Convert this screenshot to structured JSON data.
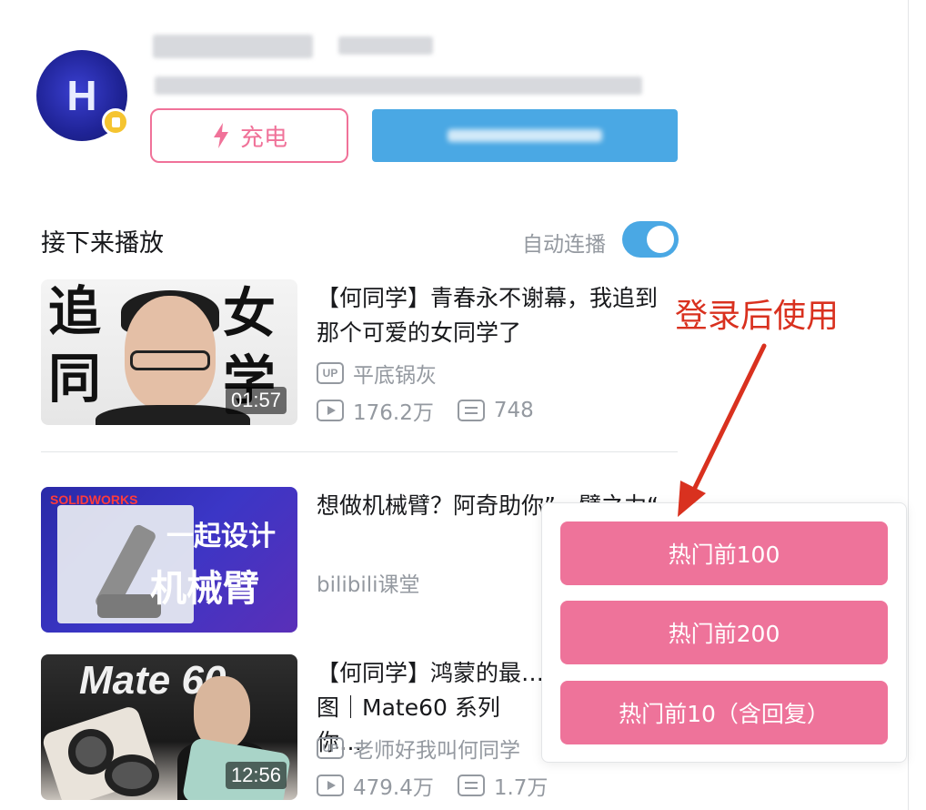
{
  "uploader": {
    "charge_label": "充电"
  },
  "next_up": {
    "title": "接下来播放",
    "autoplay_label": "自动连播",
    "autoplay_on": true
  },
  "videos": [
    {
      "title": "【何同学】青春永不谢幕，我追到那个可爱的女同学了",
      "uploader": "平底锅灰",
      "views": "176.2万",
      "danmaku": "748",
      "duration": "01:57",
      "thumb_text": [
        "追",
        "同",
        "女",
        "学"
      ]
    },
    {
      "title": "想做机械臂？阿奇助你”一臂之力“",
      "uploader": "bilibili课堂",
      "thumb_text": [
        "一起设计",
        "机械臂",
        "SOLIDWORKS"
      ]
    },
    {
      "title": "【何同学】鸿蒙的最…图｜Mate60 系列你…",
      "uploader": "老师好我叫何同学",
      "views": "479.4万",
      "danmaku": "1.7万",
      "duration": "12:56",
      "thumb_text": [
        "Mate 60"
      ]
    }
  ],
  "annotation": {
    "text": "登录后使用",
    "color": "#d9311f"
  },
  "popup": {
    "options": [
      "热门前100",
      "热门前200",
      "热门前10（含回复）"
    ],
    "button_color": "#ee739a"
  },
  "colors": {
    "accent_pink": "#f07299",
    "accent_blue": "#4aa8e4",
    "text_secondary": "#9499a0"
  },
  "icons": [
    "bolt-icon",
    "up-icon",
    "play-icon",
    "danmaku-icon"
  ]
}
